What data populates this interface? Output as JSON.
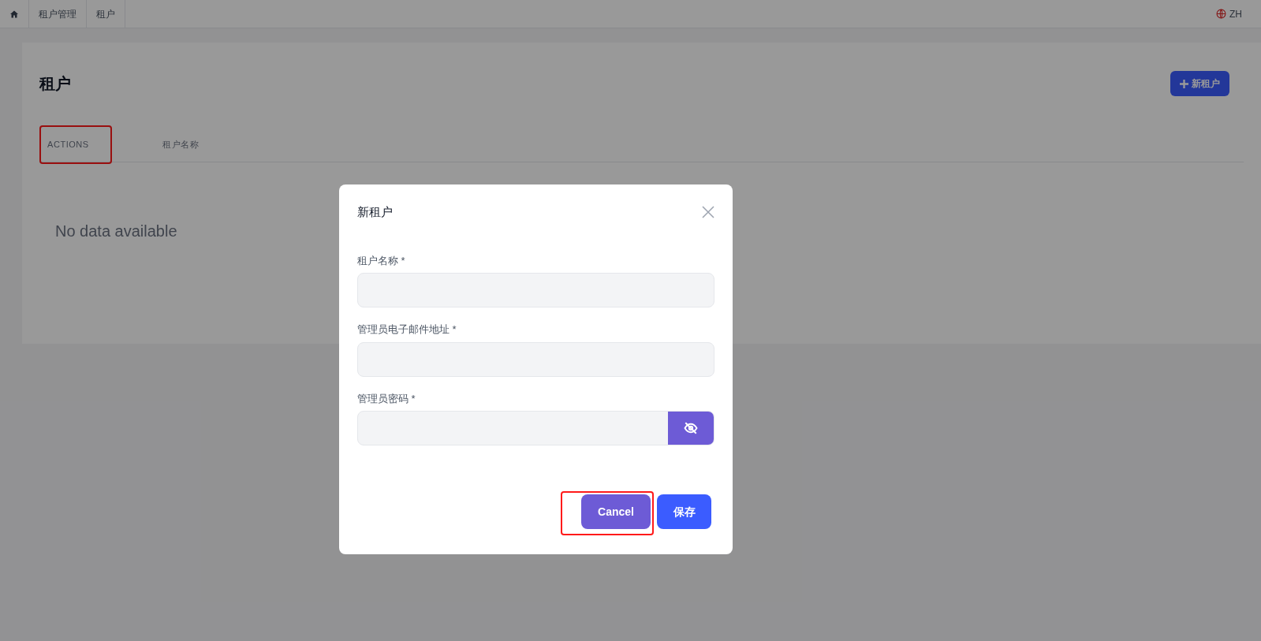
{
  "breadcrumb": [
    {
      "label": "租户管理"
    },
    {
      "label": "租户"
    }
  ],
  "language": "ZH",
  "page": {
    "title": "租户",
    "add_button": "新租户"
  },
  "table": {
    "columns": [
      {
        "label": "ACTIONS",
        "highlighted": true
      },
      {
        "label": "租户名称",
        "highlighted": false
      }
    ],
    "empty_text": "No data available"
  },
  "dialog": {
    "title": "新租户",
    "fields": [
      {
        "kind": "text",
        "label": "租户名称 *"
      },
      {
        "kind": "text",
        "label": "管理员电子邮件地址 *"
      },
      {
        "kind": "password",
        "label": "管理员密码 *"
      }
    ],
    "buttons": [
      {
        "kind": "secondary",
        "label": "Cancel",
        "highlighted": true
      },
      {
        "kind": "primary",
        "label": "保存",
        "highlighted": false
      }
    ]
  }
}
